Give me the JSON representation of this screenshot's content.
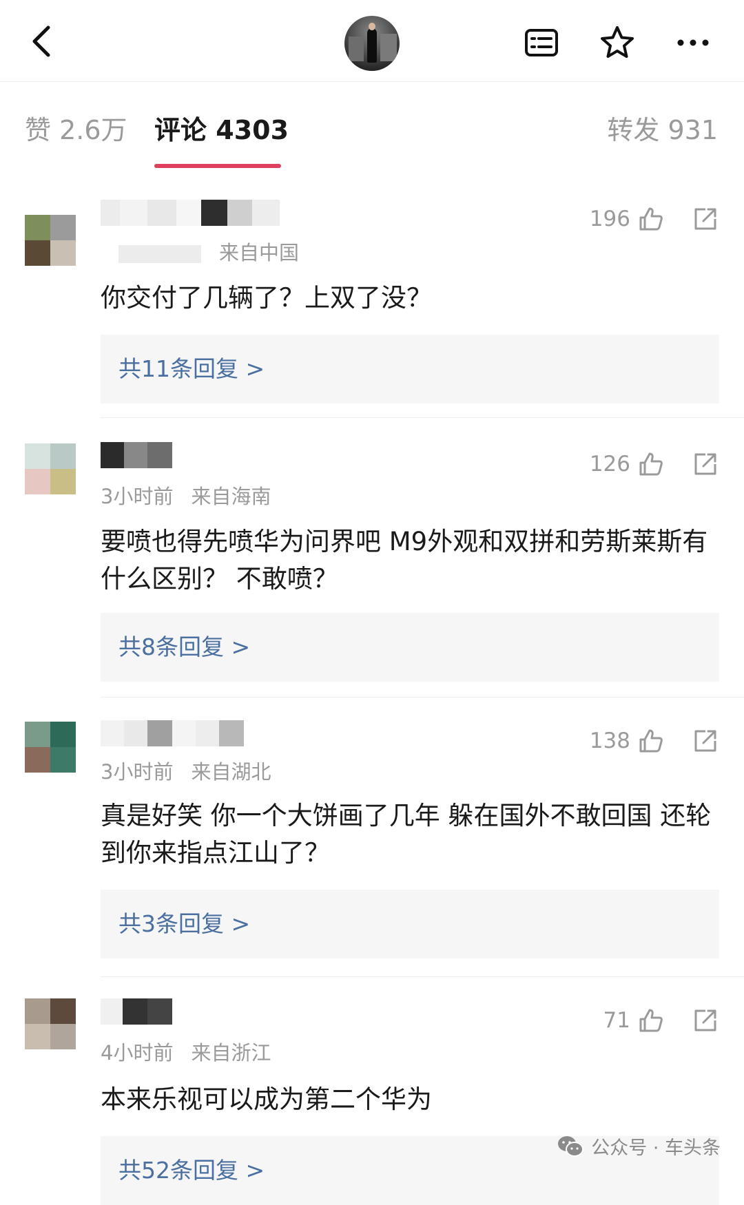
{
  "header": {
    "back_icon": "chevron-left-icon",
    "list_icon": "list-icon",
    "star_icon": "star-icon",
    "more_icon": "more-dots-icon"
  },
  "tabs": {
    "likes": {
      "label": "赞",
      "count": "2.6万"
    },
    "comments": {
      "label": "评论",
      "count": "4303",
      "active": true
    },
    "shares": {
      "label": "转发",
      "count": "931"
    },
    "active_color": "#e0405e"
  },
  "comments": [
    {
      "time": "",
      "location": "来自中国",
      "likes": "196",
      "text": "你交付了几辆了？上双了没？",
      "replies": "共11条回复 >"
    },
    {
      "time": "3小时前",
      "location": "来自海南",
      "likes": "126",
      "text": "要喷也得先喷华为问界吧 M9外观和双拼和劳斯莱斯有什么区别？ 不敢喷？",
      "replies": "共8条回复 >"
    },
    {
      "time": "3小时前",
      "location": "来自湖北",
      "likes": "138",
      "text": "真是好笑  你一个大饼画了几年 躲在国外不敢回国 还轮到你来指点江山了？",
      "replies": "共3条回复 >"
    },
    {
      "time": "4小时前",
      "location": "来自浙江",
      "likes": "71",
      "text": "本来乐视可以成为第二个华为",
      "replies": "共52条回复 >"
    }
  ],
  "watermark": {
    "text": "公众号 · 车头条"
  },
  "colors": {
    "reply_link": "#4a6fa0",
    "muted": "#9a9a9a",
    "reply_bg": "#f6f6f6"
  }
}
